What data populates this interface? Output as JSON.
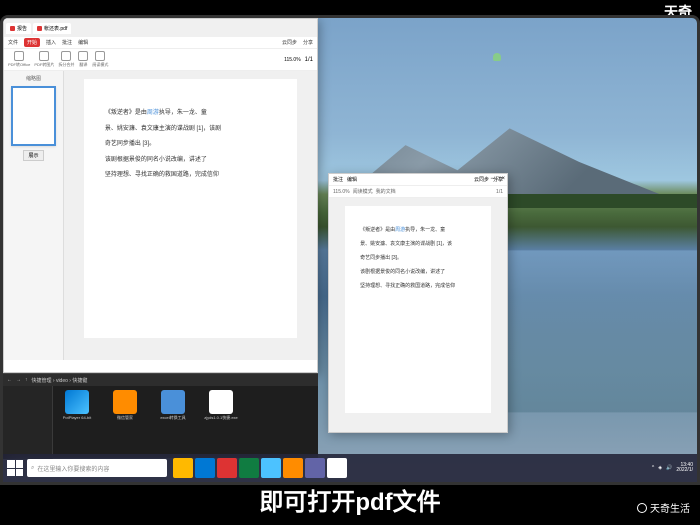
{
  "topright_brand": "天奇",
  "caption": "即可打开pdf文件",
  "bottom_brand": "天奇生活",
  "pdf1": {
    "tabs": [
      {
        "label": "报告"
      },
      {
        "label": "帐还表.pdf"
      }
    ],
    "menu": [
      "文件",
      "开始",
      "插入",
      "批注",
      "编辑"
    ],
    "menu_right": [
      "云同步",
      "分享"
    ],
    "toolbar": [
      {
        "label": "PDF转Office"
      },
      {
        "label": "PDF转图片"
      },
      {
        "label": "拆分合并"
      },
      {
        "label": "翻译"
      },
      {
        "label": "阅读模式"
      }
    ],
    "zoom": "115.0%",
    "page_info": "1/1",
    "thumbs_title": "缩略图",
    "thumb_btn": "展示",
    "doc": {
      "p1_a": "《叛逆者》",
      "p1_b": "是由",
      "p1_c": "周游",
      "p1_d": "执导，朱一龙、童",
      "p2": "景、姚安濂、袁文康主演的谍战剧 [1]，该剧",
      "p3": "奇艺同步播出 [3]。",
      "p4": "该剧根据景俊的同名小说改编，讲述了",
      "p5": "坚持理想、寻找正确的救国道路，完成信仰"
    }
  },
  "pdf2": {
    "menu": [
      "批注",
      "编辑"
    ],
    "menu_right": [
      "云同步",
      "分享"
    ],
    "zoom": "115.0%",
    "mode": "阅读模式",
    "doc_label": "我的文档",
    "page_info": "1/1",
    "doc": {
      "p1_a": "《叛逆者》",
      "p1_b": "是由",
      "p1_c": "周游",
      "p1_d": "执导，朱一龙、童",
      "p2": "景、姚安濂、袁文康主演的谍战剧 [1]，该",
      "p3": "奇艺同步播出 [3]。",
      "p4": "该剧根据景俊的同名小说改编，讲述了",
      "p5": "坚持理想、寻找正确的救国道路，完成信仰"
    }
  },
  "explorer": {
    "path": "快捷管理 › video › 快捷键",
    "files": [
      {
        "name": "PotPlayer 64-bit",
        "cls": "edge"
      },
      {
        "name": "微信管家",
        "cls": "orange"
      },
      {
        "name": "excel转换工具",
        "cls": "blue"
      },
      {
        "name": "zjyds1.0.1快捷.exe",
        "cls": "white"
      }
    ]
  },
  "taskbar": {
    "search_placeholder": "在这里输入你要搜索的内容",
    "time": "13:40",
    "date": "2022/1/"
  }
}
